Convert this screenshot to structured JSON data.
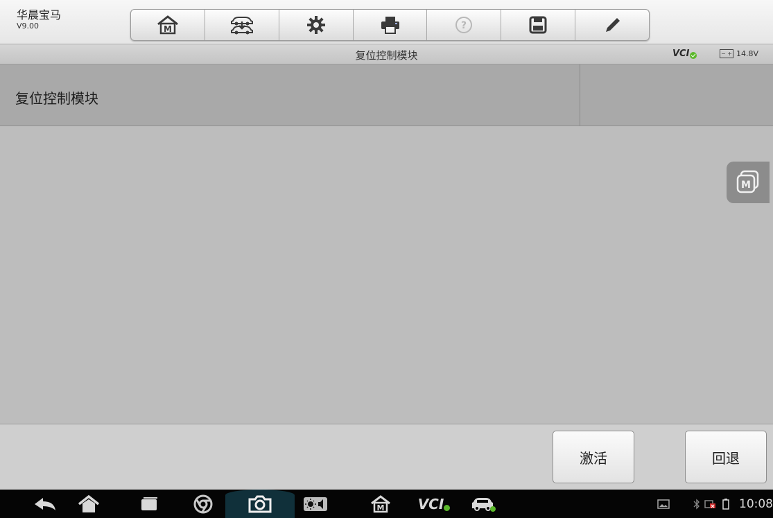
{
  "app": {
    "title": "华晨宝马",
    "version": "V9.00"
  },
  "toolbar": {
    "buttons": [
      {
        "name": "home",
        "icon": "home-m-icon"
      },
      {
        "name": "vehicle-swap",
        "icon": "vehicle-swap-icon"
      },
      {
        "name": "settings",
        "icon": "gear-icon"
      },
      {
        "name": "print",
        "icon": "printer-icon"
      },
      {
        "name": "help",
        "icon": "help-icon"
      },
      {
        "name": "save",
        "icon": "save-icon"
      },
      {
        "name": "edit",
        "icon": "pen-icon"
      }
    ]
  },
  "header": {
    "title": "复位控制模块",
    "vci_label": "VCI",
    "battery_voltage": "14.8V"
  },
  "list": {
    "items": [
      {
        "label": "复位控制模块",
        "value": ""
      }
    ]
  },
  "actions": {
    "activate_label": "激活",
    "back_label": "回退"
  },
  "statusbar": {
    "time": "10:08",
    "vci_label": "VCI"
  },
  "colors": {
    "background": "#bdbdbd",
    "list_row": "#a9a9a9",
    "vci_ok": "#5bb82b",
    "nav_bar": "#050505"
  }
}
